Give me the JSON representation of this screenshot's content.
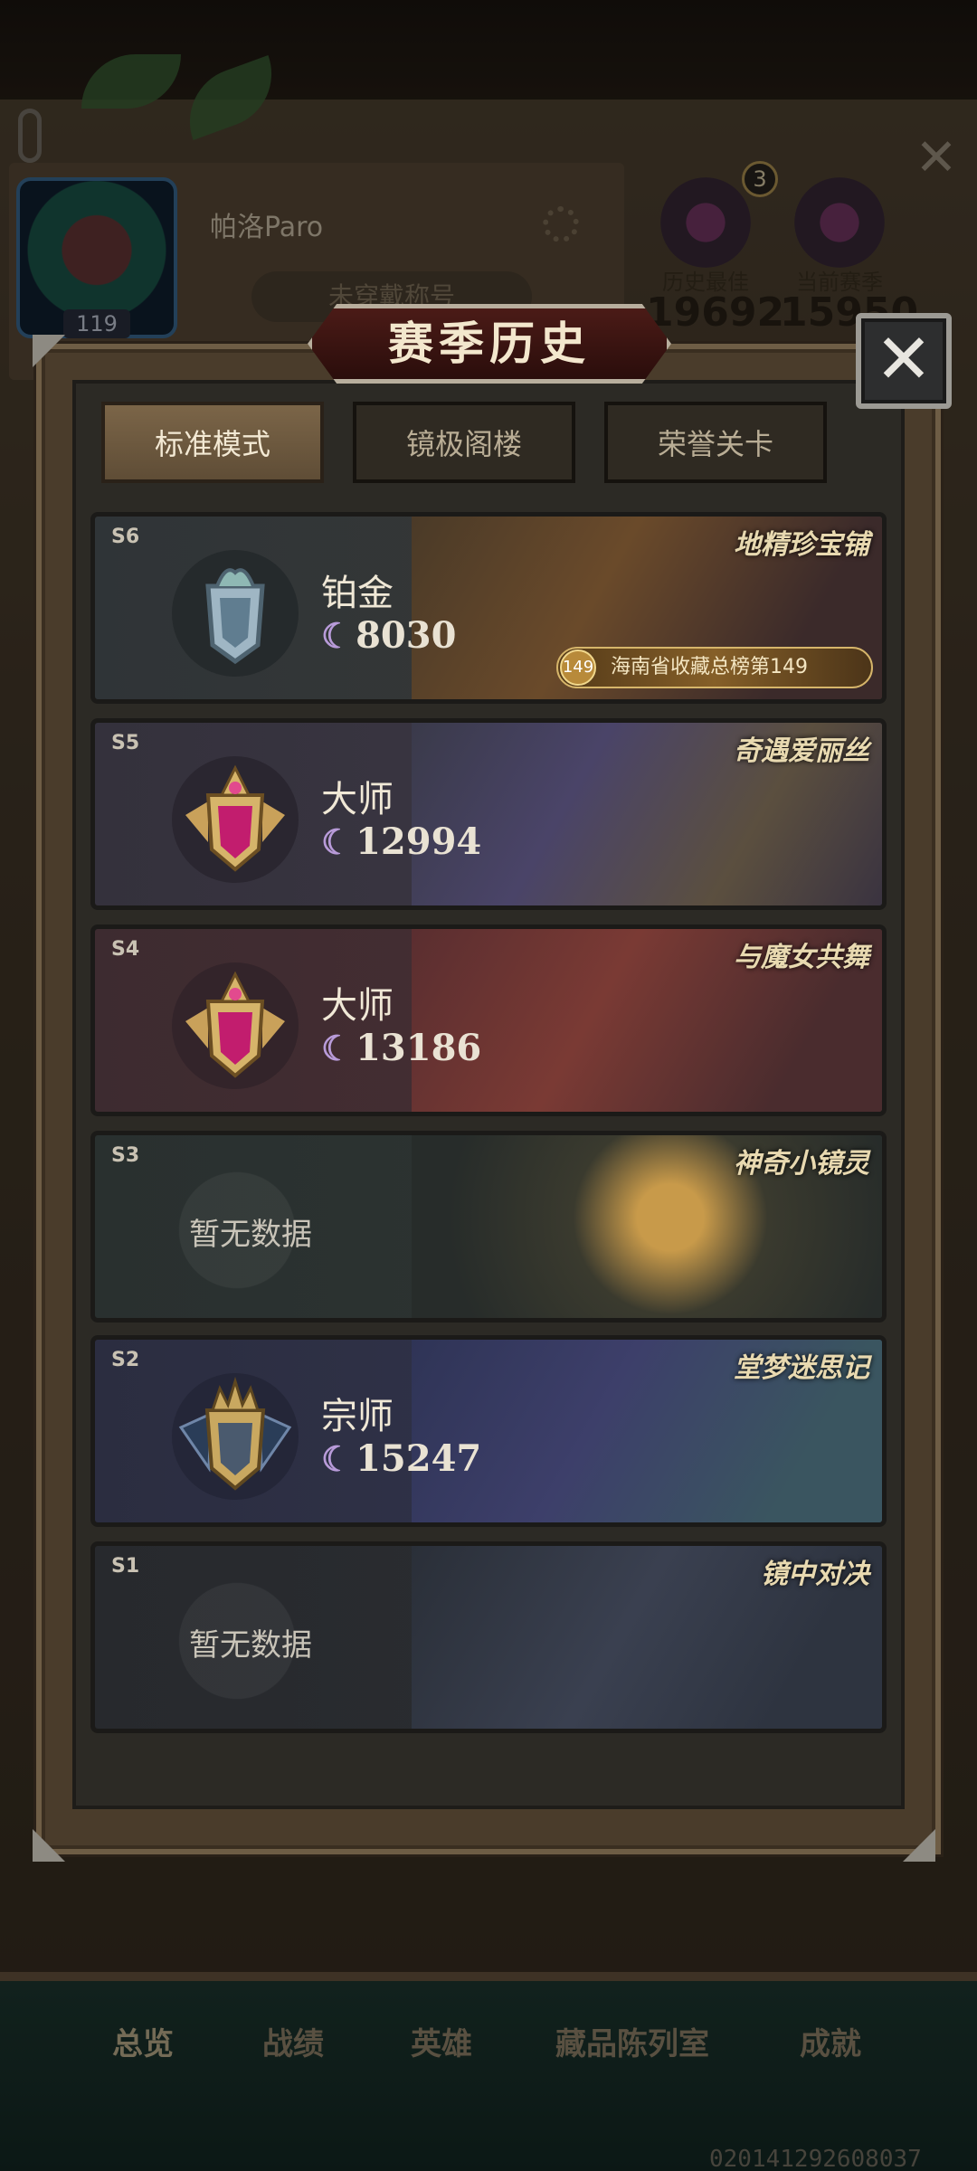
{
  "background": {
    "player": {
      "name": "帕洛Paro",
      "level": "119",
      "title_placeholder": "未穿戴称号"
    },
    "badges": {
      "count": "3",
      "history_best_label": "历史最佳",
      "current_season_label": "当前赛季",
      "history_best_score": "19692",
      "current_season_score": "15950"
    },
    "bottom_nav": [
      "总览",
      "战绩",
      "英雄",
      "藏品陈列室",
      "成就"
    ],
    "uid": "020141292608037"
  },
  "modal": {
    "title": "赛季历史",
    "close_icon": "close-icon",
    "tabs": [
      {
        "label": "标准模式",
        "active": true
      },
      {
        "label": "镜极阁楼",
        "active": false
      },
      {
        "label": "荣誉关卡",
        "active": false
      }
    ],
    "no_data_text": "暂无数据",
    "seasons": [
      {
        "tag": "S6",
        "theme": "地精珍宝铺",
        "rank": "铂金",
        "score": "8030",
        "emblem": "platinum-emblem-icon",
        "banner": {
          "rank": "149",
          "text": "海南省收藏总榜第149"
        }
      },
      {
        "tag": "S5",
        "theme": "奇遇爱丽丝",
        "rank": "大师",
        "score": "12994",
        "emblem": "master-emblem-icon"
      },
      {
        "tag": "S4",
        "theme": "与魔女共舞",
        "rank": "大师",
        "score": "13186",
        "emblem": "master-emblem-icon"
      },
      {
        "tag": "S3",
        "theme": "神奇小镜灵",
        "rank": "",
        "score": "",
        "emblem": ""
      },
      {
        "tag": "S2",
        "theme": "堂梦迷思记",
        "rank": "宗师",
        "score": "15247",
        "emblem": "grandmaster-emblem-icon"
      },
      {
        "tag": "S1",
        "theme": "镜中对决",
        "rank": "",
        "score": "",
        "emblem": ""
      }
    ],
    "moon_glyph": "☾",
    "colors": {
      "accent": "#b89bd9",
      "title_bg": "#4b1b17",
      "tab_active": "#7b6548"
    }
  }
}
